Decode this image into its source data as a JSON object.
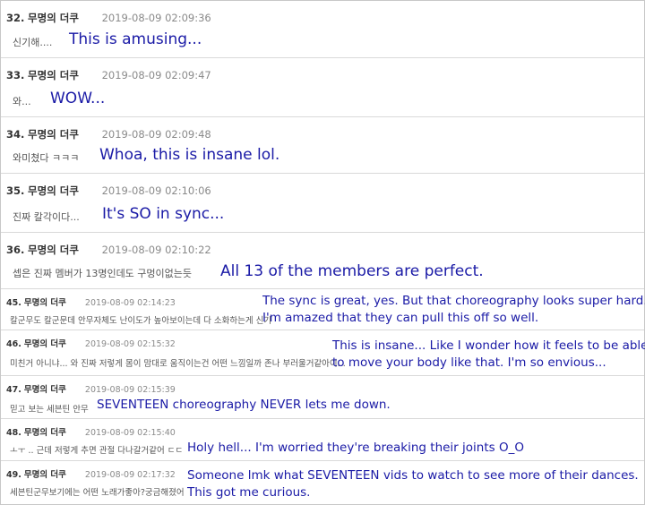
{
  "comments": [
    {
      "number": "32.",
      "author": "무명의 더쿠",
      "timestamp": "2019-08-09 02:09:36",
      "text": "신기해....",
      "translation": "This is amusing..."
    },
    {
      "number": "33.",
      "author": "무명의 더쿠",
      "timestamp": "2019-08-09 02:09:47",
      "text": "와...",
      "translation": "WOW..."
    },
    {
      "number": "34.",
      "author": "무명의 더쿠",
      "timestamp": "2019-08-09 02:09:48",
      "text": "와미쳤다 ㅋㅋㅋ",
      "translation": "Whoa, this is insane lol."
    },
    {
      "number": "35.",
      "author": "무명의 더쿠",
      "timestamp": "2019-08-09 02:10:06",
      "text": "진짜 칼각이다...",
      "translation": "It's SO in sync..."
    },
    {
      "number": "36.",
      "author": "무명의 더쿠",
      "timestamp": "2019-08-09 02:10:22",
      "text": "셉은 진짜 멤버가 13명인데도 구멍이없는듯",
      "translation": "All 13 of the members are perfect."
    },
    {
      "number": "45.",
      "author": "무명의 더쿠",
      "timestamp": "2019-08-09 02:14:23",
      "text": "칼군무도 칼군문데 안무자체도 난이도가 높아보이는데 다 소화하는게 신기",
      "translation_line1": "The sync is great, yes. But that choreography looks super hard.",
      "translation_line2": "I'm amazed that they can pull this off so well."
    },
    {
      "number": "46.",
      "author": "무명의 더쿠",
      "timestamp": "2019-08-09 02:15:32",
      "text": "미친거 아니냐... 와 진짜 저렇게 몸이 맘대로 움직이는건 어떤 느낌일까 존나 부러울거같아이...",
      "translation_line1": "This is insane... Like I wonder how it feels to be able",
      "translation_line2": "to move your body like that. I'm so envious..."
    },
    {
      "number": "47.",
      "author": "무명의 더쿠",
      "timestamp": "2019-08-09 02:15:39",
      "text": "믿고 보는 세븐틴 안무",
      "translation": "SEVENTEEN choreography NEVER lets me down."
    },
    {
      "number": "48.",
      "author": "무명의 더쿠",
      "timestamp": "2019-08-09 02:15:40",
      "text": "ㅗㅜ .. 근데 저렇게 추면 관절 다나갈거같어 ㄷㄷ",
      "translation": "Holy hell... I'm worried they're breaking their joints O_O"
    },
    {
      "number": "49.",
      "author": "무명의 더쿠",
      "timestamp": "2019-08-09 02:17:32",
      "text": "세븐틴군무보기에는 어떤 노래가좋아?궁금해졌어",
      "translation_line1": "Someone lmk what SEVENTEEN vids to watch to see more of their dances.",
      "translation_line2": "This got me curious."
    }
  ]
}
